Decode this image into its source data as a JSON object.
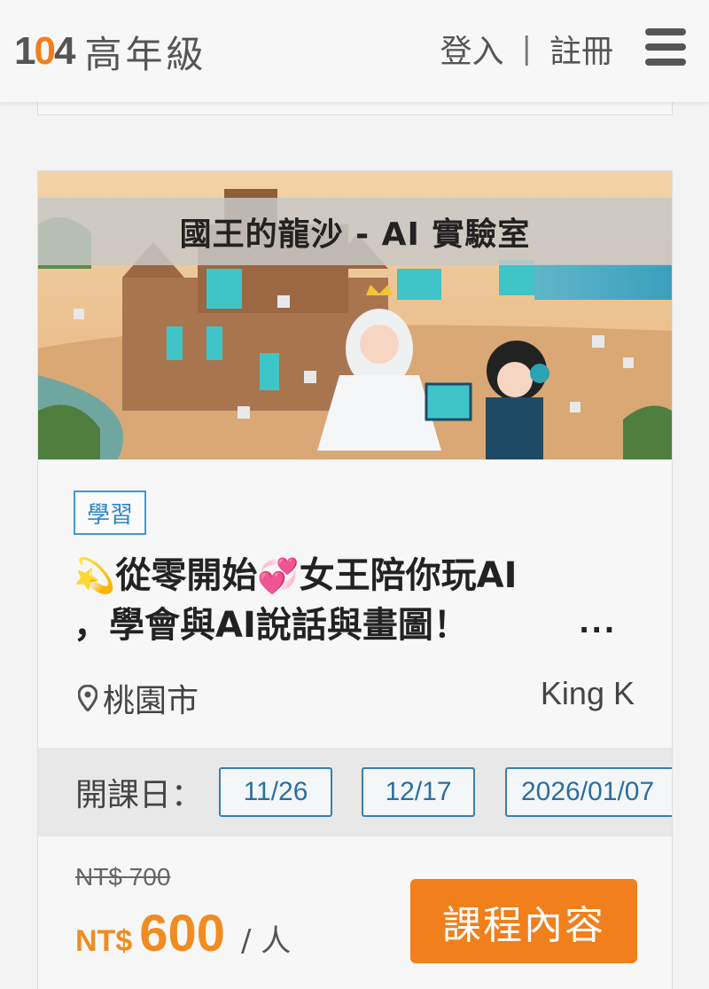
{
  "header": {
    "logo_num_1": "1",
    "logo_num_0": "0",
    "logo_num_4": "4",
    "logo_text": "高年級",
    "login": "登入",
    "separator": "|",
    "register": "註冊",
    "menu_icon": "hamburger-icon"
  },
  "course": {
    "banner_title": "國王的龍沙 - AI 實驗室",
    "tag": "學習",
    "title_emoji_1": "💫",
    "title_part_1": "從零開始",
    "title_emoji_2": "💞",
    "title_part_2": "女王陪你玩AI",
    "title_line_2": "，學會與AI說話與畫圖！",
    "ellipsis": "...",
    "location_icon": "map-pin-icon",
    "location": "桃園市",
    "teacher": "King K",
    "dates_label": "開課日：",
    "dates": [
      "11/26",
      "12/17",
      "2026/01/07"
    ],
    "old_price": "NT$ 700",
    "currency": "NT$",
    "price": "600",
    "unit": "/ 人",
    "cta": "課程內容"
  },
  "colors": {
    "accent": "#f07f1c",
    "tag_blue": "#2c86c8",
    "chip_blue": "#3b7fb0"
  }
}
